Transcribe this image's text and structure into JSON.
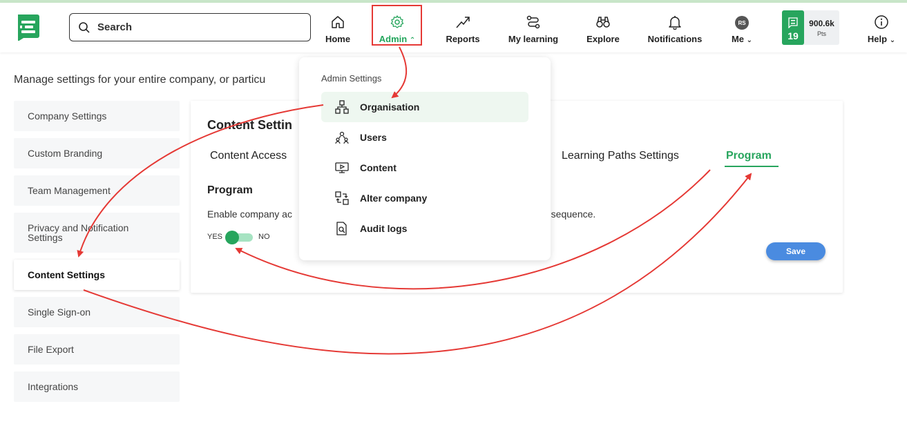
{
  "header": {
    "search_placeholder": "Search",
    "nav": [
      {
        "label": "Home",
        "icon": "home-icon"
      },
      {
        "label": "Admin",
        "icon": "gear-icon"
      },
      {
        "label": "Reports",
        "icon": "trend-up-icon"
      },
      {
        "label": "My learning",
        "icon": "path-icon"
      },
      {
        "label": "Explore",
        "icon": "binoculars-icon"
      },
      {
        "label": "Notifications",
        "icon": "bell-icon"
      },
      {
        "label": "Me",
        "icon": "avatar"
      },
      {
        "label": "Help",
        "icon": "info-icon"
      }
    ],
    "avatar_initials": "RS",
    "points": {
      "level": "19",
      "value": "900.6k",
      "unit": "Pts"
    }
  },
  "page": {
    "intro": "Manage settings for your entire company, or particu"
  },
  "sidebar": {
    "items": [
      {
        "label": "Company Settings"
      },
      {
        "label": "Custom Branding"
      },
      {
        "label": "Team Management"
      },
      {
        "label": "Privacy and Notification Settings"
      },
      {
        "label": "Content Settings"
      },
      {
        "label": "Single Sign-on"
      },
      {
        "label": "File Export"
      },
      {
        "label": "Integrations"
      }
    ]
  },
  "content": {
    "title": "Content Settin",
    "tabs": [
      {
        "label": "Content Access"
      },
      {
        "label": "Learning Paths Settings"
      },
      {
        "label": "Program"
      }
    ],
    "section_title": "Program",
    "description_start": "Enable company ac",
    "description_end": "n sequence.",
    "toggle_yes": "YES",
    "toggle_no": "NO",
    "toggle_enabled": true,
    "save_label": "Save"
  },
  "admin_menu": {
    "heading": "Admin Settings",
    "items": [
      {
        "label": "Organisation",
        "icon": "organisation-icon"
      },
      {
        "label": "Users",
        "icon": "users-icon"
      },
      {
        "label": "Content",
        "icon": "content-icon"
      },
      {
        "label": "Alter company",
        "icon": "alter-company-icon"
      },
      {
        "label": "Audit logs",
        "icon": "audit-logs-icon"
      }
    ]
  },
  "colors": {
    "brand_green": "#27a55d",
    "annotation_red": "#e53935",
    "save_blue": "#4a8be0"
  }
}
